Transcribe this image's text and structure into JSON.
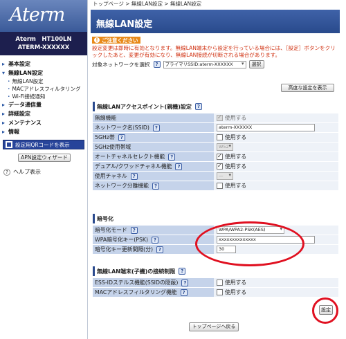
{
  "sidebar": {
    "logo": "Aterm",
    "model": "Aterm　HT100LN",
    "device_id": "ATERM-XXXXXX",
    "menu": [
      {
        "label": "基本設定",
        "type": "cat"
      },
      {
        "label": "無線LAN設定",
        "type": "cat"
      },
      {
        "label": "無線LAN設定",
        "type": "sub"
      },
      {
        "label": "MACアドレスフィルタリング",
        "type": "sub"
      },
      {
        "label": "Wi-Fi接続通知",
        "type": "sub"
      },
      {
        "label": "データ通信量",
        "type": "cat"
      },
      {
        "label": "詳細設定",
        "type": "cat"
      },
      {
        "label": "メンテナンス",
        "type": "cat"
      },
      {
        "label": "情報",
        "type": "cat"
      }
    ],
    "qr_button": "設定用QRコードを表示",
    "apn_button": "APN設定ウィザード",
    "help": "ヘルプ表示"
  },
  "main": {
    "breadcrumb": "トップページ > 無線LAN設定 > 無線LAN設定",
    "title": "無線LAN設定",
    "notice_label": "ご注意ください",
    "notice_text": "設定変更は即時に有効となります。無線LAN端末から設定を行っている場合には、［設定］ボタンをクリックしたあと、変更が有効になり、無線LAN接続が切断される場合があります。",
    "target_label": "対象ネットワークを選択",
    "target_help": "?",
    "target_value": "プライマリSSID:aterm-XXXXXX",
    "select_button": "選択",
    "advanced_button": "高度な設定を表示"
  },
  "sections": {
    "ap": {
      "title": "無線LANアクセスポイント(親機)設定",
      "rows": [
        {
          "label": "無線機能",
          "value": "使用する"
        },
        {
          "label": "ネットワーク名(SSID)",
          "value": "aterm-XXXXXX"
        },
        {
          "label": "5GHz帯",
          "value": "使用する"
        },
        {
          "label": "5GHz使用帯域",
          "value": "W52"
        },
        {
          "label": "オートチャネルセレクト機能",
          "value": "使用する"
        },
        {
          "label": "デュアル/クワッドチャネル機能",
          "value": "使用する"
        },
        {
          "label": "使用チャネル",
          "value": "—"
        },
        {
          "label": "ネットワーク分離機能",
          "value": "使用する"
        }
      ]
    },
    "enc": {
      "title": "暗号化",
      "rows": [
        {
          "label": "暗号化モード",
          "value": "WPA/WPA2-PSK(AES)"
        },
        {
          "label": "WPA暗号化キー(PSK)",
          "value": "xxxxxxxxxxxxxx"
        },
        {
          "label": "暗号化キー更新間隔(分)",
          "value": "30"
        }
      ]
    },
    "client": {
      "title": "無線LAN端末(子機)の接続制限",
      "rows": [
        {
          "label": "ESS-IDステルス機能(SSIDの隠蔽)",
          "value": "使用する"
        },
        {
          "label": "MACアドレスフィルタリング機能",
          "value": "使用する"
        }
      ]
    }
  },
  "buttons": {
    "setting": "設定",
    "back_top": "トップページへ戻る"
  },
  "help_mark": "?",
  "colors": {
    "title_bar": "#294a8c",
    "notice_text": "#d03010",
    "annotation_oval": "#e01020"
  }
}
